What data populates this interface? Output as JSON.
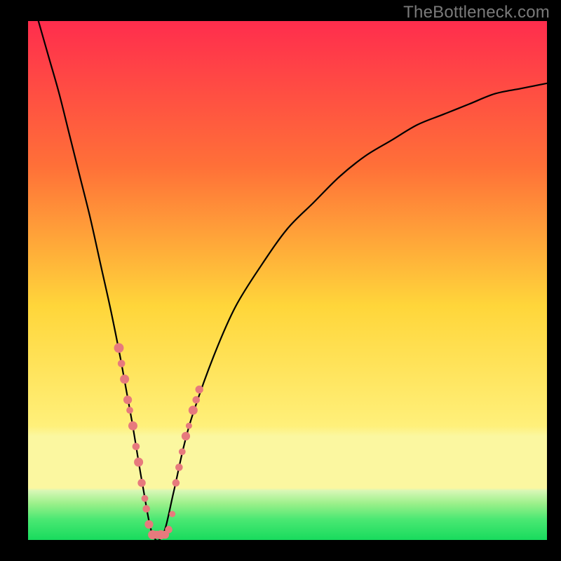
{
  "watermark": {
    "text": "TheBottleneck.com"
  },
  "colors": {
    "bg_black": "#000000",
    "grad_top": "#ff2d4d",
    "grad_mid1": "#ff7a3a",
    "grad_mid2": "#ffd93a",
    "grad_mid3": "#fff07a",
    "grad_bottom_band": "#fbf7a0",
    "grad_green_light": "#b6f59a",
    "grad_green": "#2fe36a",
    "curve": "#000000",
    "dot": "#e77a7d"
  },
  "chart_data": {
    "type": "line",
    "title": "",
    "xlabel": "",
    "ylabel": "",
    "xlim": [
      0,
      100
    ],
    "ylim": [
      0,
      100
    ],
    "legend": false,
    "grid": false,
    "description": "Bottleneck-style curve. Y is relative bottleneck (%) where 0% is ideal (bottom green band) and 100% is worst (top red). Curve dips to ~0% near x≈24 then rises toward the right.",
    "series": [
      {
        "name": "bottleneck-curve",
        "x": [
          2,
          4,
          6,
          8,
          10,
          12,
          14,
          16,
          18,
          20,
          22,
          24,
          26,
          28,
          30,
          32,
          36,
          40,
          45,
          50,
          55,
          60,
          65,
          70,
          75,
          80,
          85,
          90,
          95,
          100
        ],
        "values": [
          100,
          93,
          86,
          78,
          70,
          62,
          53,
          44,
          34,
          23,
          11,
          1,
          1,
          9,
          18,
          25,
          36,
          45,
          53,
          60,
          65,
          70,
          74,
          77,
          80,
          82,
          84,
          86,
          87,
          88
        ]
      }
    ],
    "dots": {
      "name": "highlight-dots",
      "note": "Pink/coral dots clustered around the valley of the curve.",
      "points": [
        {
          "x": 17.5,
          "y": 37,
          "r": 1.7
        },
        {
          "x": 18.0,
          "y": 34,
          "r": 1.3
        },
        {
          "x": 18.6,
          "y": 31,
          "r": 1.6
        },
        {
          "x": 19.2,
          "y": 27,
          "r": 1.5
        },
        {
          "x": 19.6,
          "y": 25,
          "r": 1.2
        },
        {
          "x": 20.2,
          "y": 22,
          "r": 1.6
        },
        {
          "x": 20.8,
          "y": 18,
          "r": 1.3
        },
        {
          "x": 21.3,
          "y": 15,
          "r": 1.6
        },
        {
          "x": 21.9,
          "y": 11,
          "r": 1.4
        },
        {
          "x": 22.5,
          "y": 8,
          "r": 1.2
        },
        {
          "x": 22.8,
          "y": 6,
          "r": 1.3
        },
        {
          "x": 23.3,
          "y": 3,
          "r": 1.5
        },
        {
          "x": 24.0,
          "y": 1,
          "r": 1.6
        },
        {
          "x": 24.8,
          "y": 1,
          "r": 1.4
        },
        {
          "x": 25.6,
          "y": 1,
          "r": 1.6
        },
        {
          "x": 26.4,
          "y": 1,
          "r": 1.4
        },
        {
          "x": 27.1,
          "y": 2,
          "r": 1.3
        },
        {
          "x": 27.8,
          "y": 5,
          "r": 1.1
        },
        {
          "x": 28.5,
          "y": 11,
          "r": 1.3
        },
        {
          "x": 29.1,
          "y": 14,
          "r": 1.3
        },
        {
          "x": 29.7,
          "y": 17,
          "r": 1.2
        },
        {
          "x": 30.4,
          "y": 20,
          "r": 1.5
        },
        {
          "x": 31.0,
          "y": 22,
          "r": 1.1
        },
        {
          "x": 31.8,
          "y": 25,
          "r": 1.6
        },
        {
          "x": 32.4,
          "y": 27,
          "r": 1.3
        },
        {
          "x": 33.0,
          "y": 29,
          "r": 1.4
        }
      ]
    },
    "gradient_stops": [
      {
        "offset": 0.0,
        "color": "#ff2d4d"
      },
      {
        "offset": 0.28,
        "color": "#ff7038"
      },
      {
        "offset": 0.55,
        "color": "#ffd63a"
      },
      {
        "offset": 0.78,
        "color": "#fff07a"
      },
      {
        "offset": 0.8,
        "color": "#fbf7a0"
      },
      {
        "offset": 0.9,
        "color": "#fbf7a0"
      },
      {
        "offset": 0.905,
        "color": "#d8f7b6"
      },
      {
        "offset": 0.93,
        "color": "#9bf08a"
      },
      {
        "offset": 0.96,
        "color": "#4be873"
      },
      {
        "offset": 1.0,
        "color": "#18db5d"
      }
    ]
  }
}
